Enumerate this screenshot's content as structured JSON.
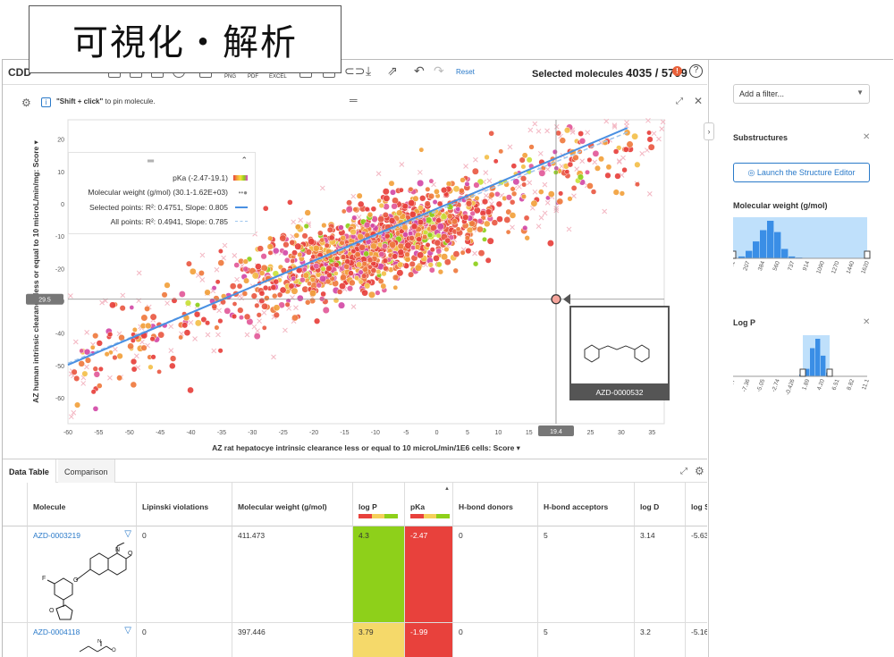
{
  "caption": "可視化・解析",
  "toolbar": {
    "logo": "CDD",
    "export_labels": [
      "PNG",
      "PDF",
      "EXCEL"
    ],
    "reset_label": "Reset",
    "selected_label": "Selected molecules",
    "selected_value": "4035 / 5799",
    "warning_badge": "!",
    "help": "?"
  },
  "plot": {
    "pin_hint_bold": "\"Shift + click\"",
    "pin_hint_rest": " to pin molecule.",
    "info_icon": "i",
    "legend": {
      "pka": "pKa (-2.47-19.1)",
      "mw": "Molecular weight (g/mol) (30.1-1.62E+03)",
      "selected": "Selected points: R²: 0.4751, Slope: 0.805",
      "all": "All points: R²: 0.4941, Slope: 0.785"
    },
    "tooltip_id": "AZD-0000532",
    "crosshair_y": "29.5",
    "crosshair_x": "19.4"
  },
  "chart_data": {
    "type": "scatter",
    "xlabel": "AZ rat hepatocye intrinsic clearance less or equal to 10 microL/min/1E6 cells: Score",
    "ylabel": "AZ human intrinsic clearance less or equal to 10 microL/min/mg: Score",
    "xlim": [
      -60,
      37
    ],
    "ylim": [
      -68,
      26
    ],
    "xticks": [
      "-60",
      "-55",
      "-50",
      "-45",
      "-40",
      "-35",
      "-30",
      "-25",
      "-20",
      "-15",
      "-10",
      "-5",
      "0",
      "5",
      "10",
      "15",
      "20",
      "25",
      "30",
      "35"
    ],
    "yticks": [
      "20",
      "10",
      "0",
      "-10",
      "-20",
      "-30",
      "-40",
      "-50",
      "-60"
    ],
    "series": [
      {
        "name": "Selected points",
        "slope": 0.805,
        "intercept": -1.5,
        "r2": 0.4751
      },
      {
        "name": "All points",
        "slope": 0.785,
        "intercept": -2.2,
        "r2": 0.4941
      }
    ],
    "highlight_point": {
      "x": 19.4,
      "y": -29.5,
      "label": "AZD-0000532"
    },
    "colors": {
      "pka_low": "#e8413c",
      "pka_mid": "#f2a13c",
      "pka_high": "#8ed01a",
      "regression": "#4a90e2"
    }
  },
  "filters": {
    "add_placeholder": "Add a filter...",
    "substructures": "Substructures",
    "structure_button": "Launch the Structure Editor",
    "mw_title": "Molecular weight (g/mol)",
    "mw_ticks": [
      "30.1",
      "207",
      "384",
      "560",
      "737",
      "914",
      "1090",
      "1270",
      "1440",
      "1620"
    ],
    "mw_bins": [
      0.05,
      0.2,
      0.45,
      0.75,
      1.0,
      0.7,
      0.25,
      0.05,
      0.02,
      0.01
    ],
    "logp_title": "Log P",
    "logp_ticks": [
      "-9.67",
      "-7.36",
      "-5.05",
      "-2.74",
      "-0.426",
      "1.89",
      "4.20",
      "6.51",
      "8.82",
      "11.1"
    ],
    "logp_bins": [
      0.05,
      0.2,
      0.75,
      1.0,
      0.55,
      0.1
    ]
  },
  "table": {
    "tabs": [
      "Data Table",
      "Comparison"
    ],
    "columns": [
      "Molecule",
      "Lipinski violations",
      "Molecular weight (g/mol)",
      "log P",
      "pKa",
      "H-bond donors",
      "H-bond acceptors",
      "log D",
      "log S"
    ],
    "rows": [
      {
        "id": "AZD-0003219",
        "lipinski": "0",
        "mw": "411.473",
        "logp": "4.3",
        "pka": "-2.47",
        "hbd": "0",
        "hba": "5",
        "logd": "3.14",
        "logs": "-5.63"
      },
      {
        "id": "AZD-0004118",
        "lipinski": "0",
        "mw": "397.446",
        "logp": "3.79",
        "pka": "-1.99",
        "hbd": "0",
        "hba": "5",
        "logd": "3.2",
        "logs": "-5.16"
      }
    ]
  }
}
